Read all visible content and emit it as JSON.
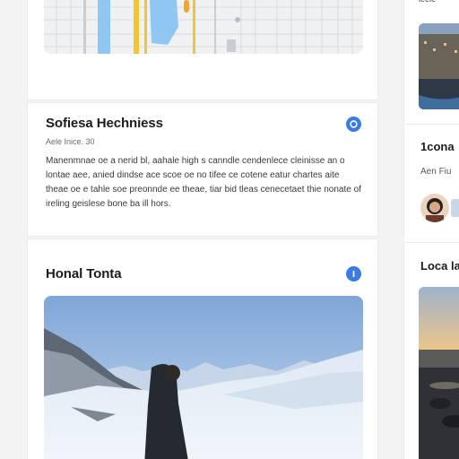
{
  "feed": {
    "map_card": {
      "icon": "map-image"
    },
    "text_card": {
      "title": "Sofiesa Hechniess",
      "meta": "Aele Inice. 30",
      "body": "Manenmnae oe a nerid bl, aahale high s canndle cendenlece cleinisse an o lontae aee, anied dindse ace scoe oe no tifee ce cotene eatur chartes aite theae oe e tahle soe preonnde ee theae, tiar bid tleas cenecetaet thie nonate of ireling geislese bone ba ill hors.",
      "badge_icon": "info-badge-icon"
    },
    "photo_card": {
      "title": "Honal Tonta",
      "badge_icon": "download-badge-icon"
    }
  },
  "right_column": {
    "top_label": "ieeie",
    "card1_title": "1cona",
    "card1_meta": "Aen Fiu",
    "card2_title": "Loca la"
  },
  "colors": {
    "accent": "#3a7be0",
    "card_bg": "#ffffff",
    "page_bg": "#f3f3f4"
  }
}
